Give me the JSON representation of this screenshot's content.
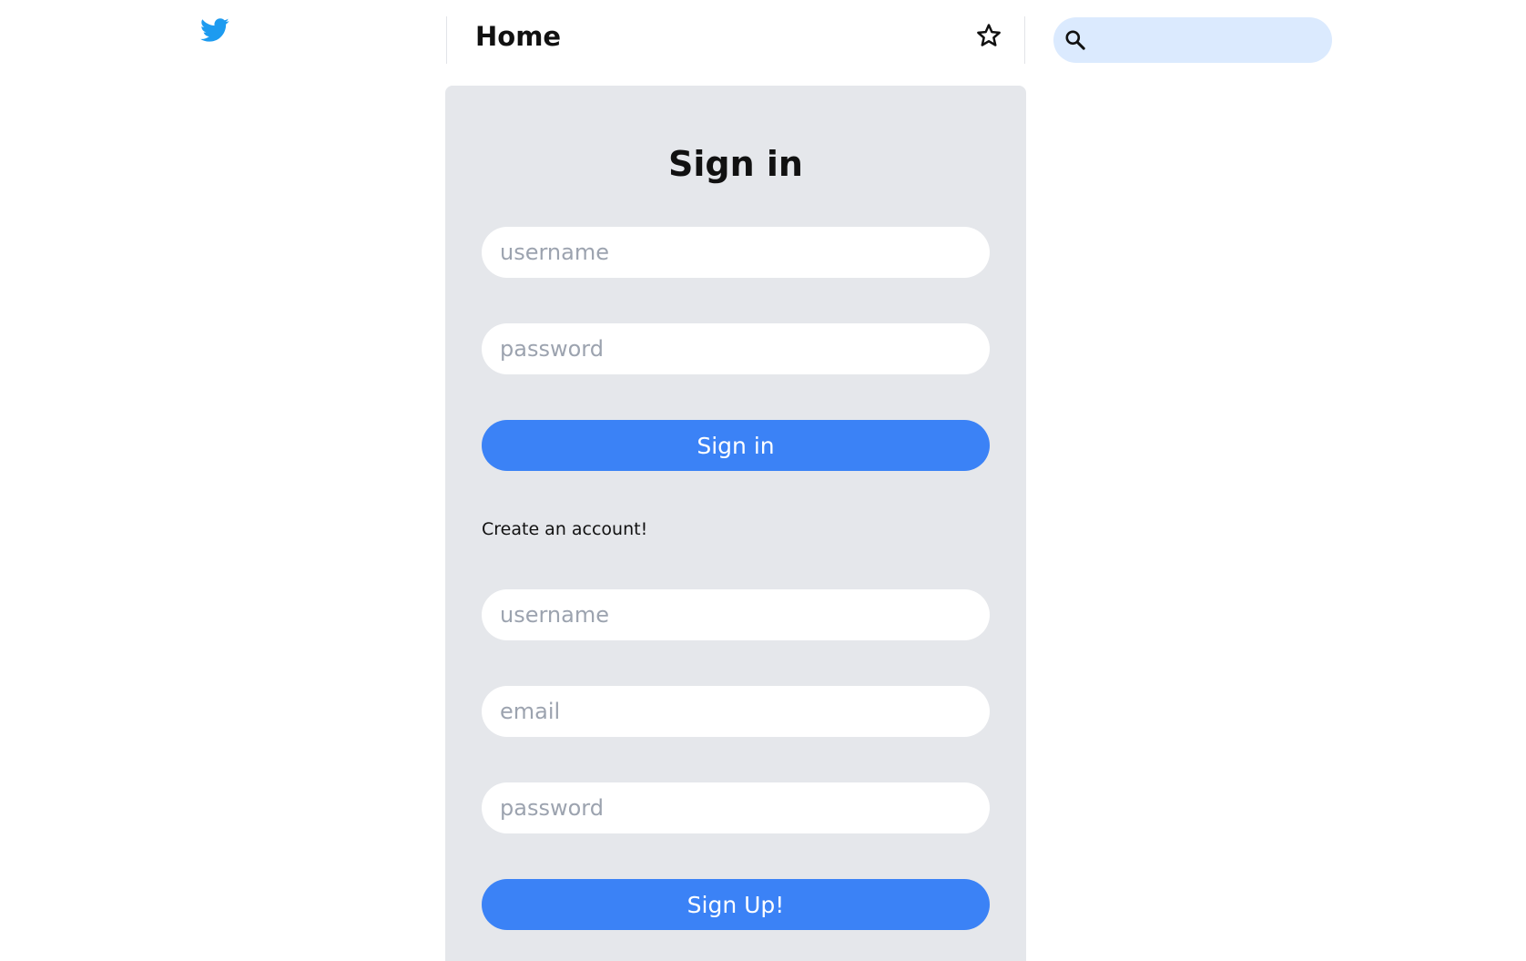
{
  "header": {
    "title": "Home"
  },
  "search": {
    "placeholder": ""
  },
  "signin": {
    "title": "Sign in",
    "username_placeholder": "username",
    "password_placeholder": "password",
    "button_label": "Sign in"
  },
  "signup": {
    "prompt": "Create an account!",
    "username_placeholder": "username",
    "email_placeholder": "email",
    "password_placeholder": "password",
    "button_label": "Sign Up!"
  },
  "icons": {
    "logo": "twitter-bird-icon",
    "favorites": "star-icon",
    "search": "search-icon"
  },
  "colors": {
    "brand_blue": "#1d9bf0",
    "button_blue": "#3b82f6",
    "panel_bg": "#e5e7eb",
    "search_bg": "#dbeafe"
  }
}
